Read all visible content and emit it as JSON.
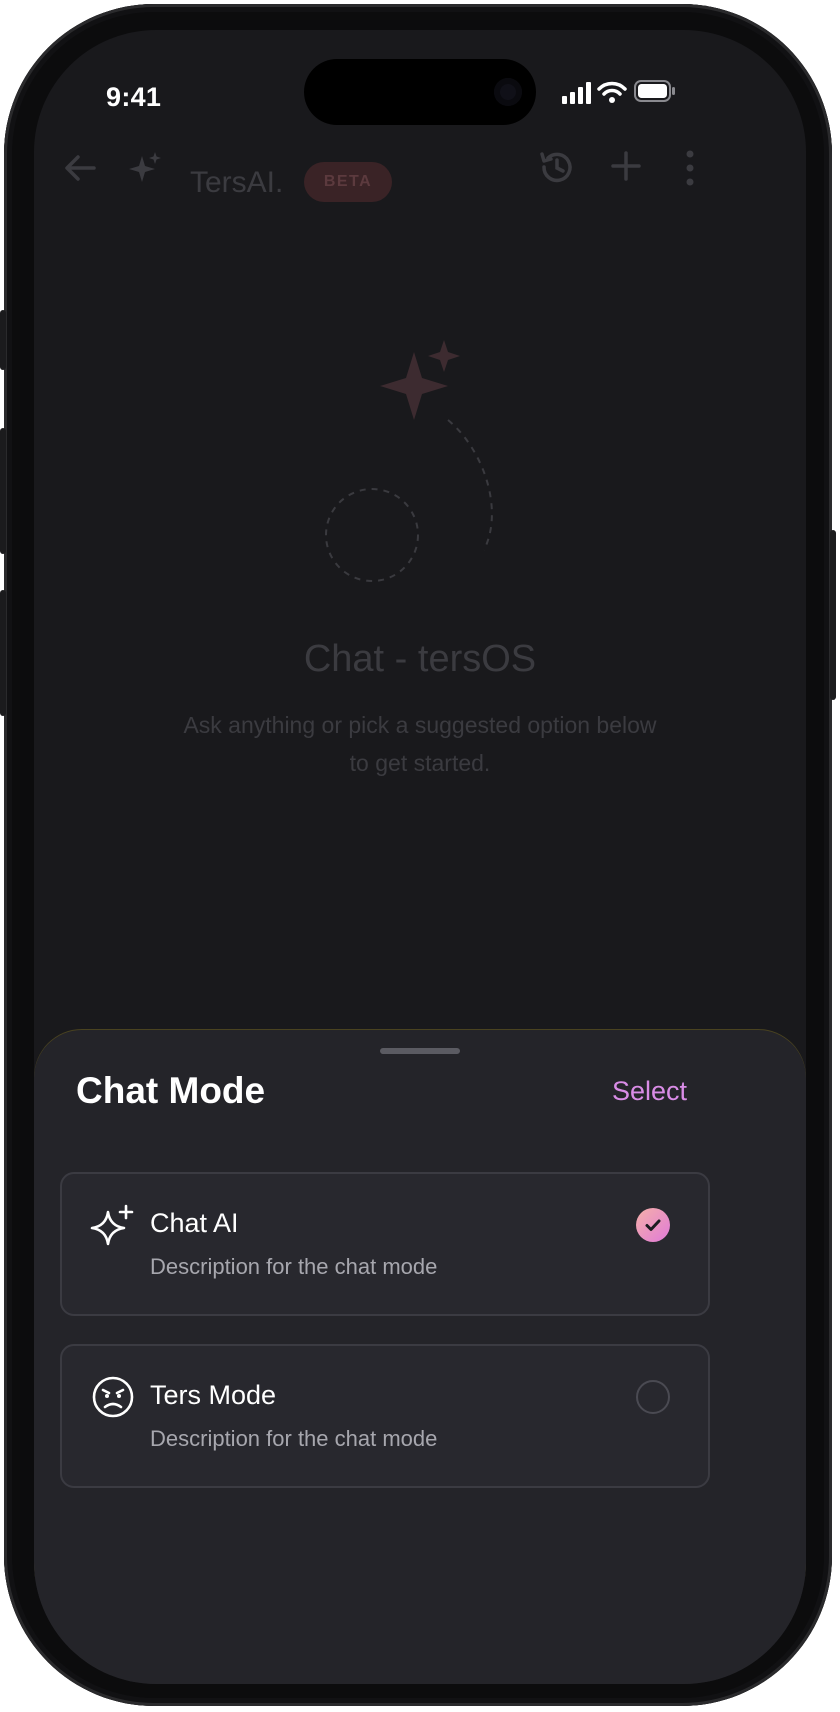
{
  "status": {
    "time": "9:41"
  },
  "header": {
    "title": "TersAI.",
    "badge": "BETA"
  },
  "empty_state": {
    "title": "Chat - tersOS",
    "subtitle_line1": "Ask anything or pick a suggested option below",
    "subtitle_line2": "to get started."
  },
  "sheet": {
    "title": "Chat Mode",
    "action": "Select",
    "options": [
      {
        "title": "Chat AI",
        "description": "Description for the chat mode",
        "icon": "sparkle-plus-icon",
        "selected": true
      },
      {
        "title": "Ters Mode",
        "description": "Description for the chat mode",
        "icon": "angry-face-icon",
        "selected": false
      }
    ]
  },
  "colors": {
    "accent_start": "#f0a0b0",
    "accent_end": "#e07ad8",
    "select": "#d98ce6"
  }
}
